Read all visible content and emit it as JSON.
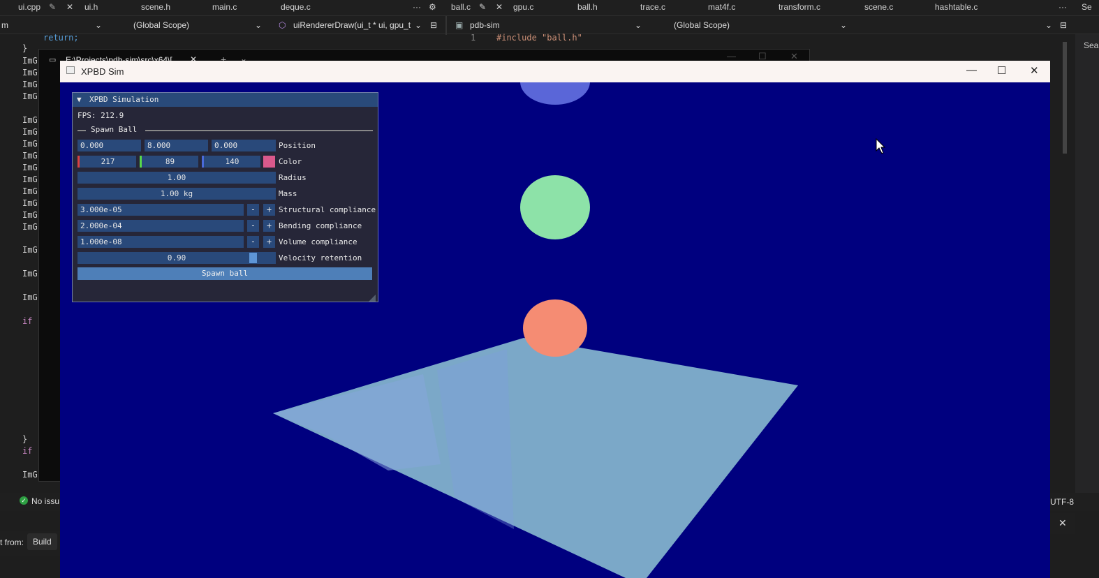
{
  "ide": {
    "left_tabs": [
      "ui.cpp",
      "ui.h",
      "scene.h",
      "main.c",
      "deque.c"
    ],
    "right_tabs": [
      "ball.c",
      "gpu.c",
      "ball.h",
      "trace.c",
      "mat4f.c",
      "transform.c",
      "scene.c",
      "hashtable.c"
    ],
    "more_label": "···",
    "left_nav": {
      "scope_fragment": "m",
      "scope": "(Global Scope)",
      "function": "uiRendererDraw(ui_t * ui, gpu_t"
    },
    "right_nav": {
      "project": "pdb-sim",
      "scope": "(Global Scope)"
    },
    "search_fragment": "Sea",
    "code_right": {
      "line_number": "1",
      "line_text": "#include \"ball.h\""
    },
    "code_left": {
      "return_line": "return;",
      "brace_close": "}",
      "img_lines": [
        "ImG",
        "ImG",
        "ImG",
        "ImG",
        "ImG",
        "ImG",
        "ImG",
        "ImG",
        "ImG",
        "ImG",
        "ImG",
        "ImG",
        "ImG",
        "ImG",
        "ImG",
        "ImG"
      ],
      "if_1": "if",
      "brace_2": "}",
      "if_2": "if",
      "img_last": "ImG"
    },
    "terminal_tab_title": "E:\\Projects\\pdb-sim\\src\\x64\\[",
    "status_issues": "No issu",
    "encoding": "UTF-8",
    "output_from_label": "t from:",
    "output_source": "Build"
  },
  "window": {
    "title": "XPBD Sim"
  },
  "scene": {
    "background_color": "#00007f",
    "plane_color": "#7ba8c8",
    "balls": [
      {
        "name": "blue-ball",
        "color": "#5a66d8"
      },
      {
        "name": "green-ball",
        "color": "#8de2a8"
      },
      {
        "name": "salmon-ball",
        "color": "#f58c73"
      }
    ]
  },
  "panel": {
    "title": "XPBD Simulation",
    "fps_label": "FPS: 212.9",
    "section": "Spawn Ball",
    "position": {
      "x": "0.000",
      "y": "8.000",
      "z": "0.000",
      "label": "Position"
    },
    "color": {
      "r": "217",
      "g": "89",
      "b": "140",
      "label": "Color",
      "swatch": "#d9598c"
    },
    "radius": {
      "value": "1.00",
      "label": "Radius"
    },
    "mass": {
      "value": "1.00 kg",
      "label": "Mass"
    },
    "structural": {
      "value": "3.000e-05",
      "label": "Structural compliance"
    },
    "bending": {
      "value": "2.000e-04",
      "label": "Bending compliance"
    },
    "volume": {
      "value": "1.000e-08",
      "label": "Volume compliance"
    },
    "velocity": {
      "value": "0.90",
      "label": "Velocity retention",
      "fraction": 0.9
    },
    "minus": "-",
    "plus": "+",
    "spawn_button": "Spawn ball"
  }
}
